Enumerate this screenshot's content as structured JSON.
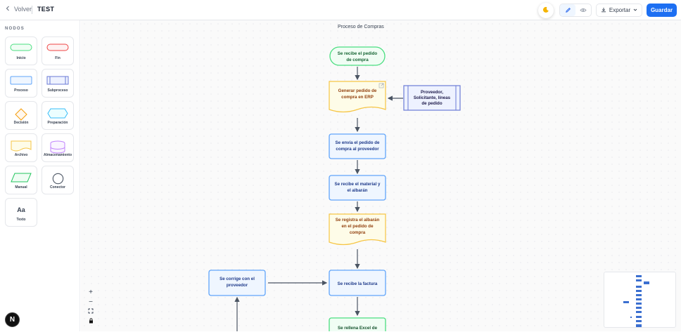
{
  "header": {
    "back_label": "Volver",
    "doc_title": "TEST",
    "export_label": "Exportar",
    "save_label": "Guardar"
  },
  "sidebar": {
    "title": "NODOS",
    "nodes": [
      {
        "label": "Inicio"
      },
      {
        "label": "Fin"
      },
      {
        "label": "Proceso"
      },
      {
        "label": "Subproceso"
      },
      {
        "label": "Decisión"
      },
      {
        "label": "Preparación"
      },
      {
        "label": "Archivo"
      },
      {
        "label": "Almacenamiento"
      },
      {
        "label": "Manual"
      },
      {
        "label": "Conector"
      },
      {
        "label": "Texto",
        "glyph": "Aa"
      }
    ]
  },
  "canvas": {
    "title": "Proceso de Compras",
    "nodes": {
      "start": [
        "Se recibe el pedido",
        "de compra"
      ],
      "erp": [
        "Generar pedido de",
        "compra en ERP"
      ],
      "supplier": [
        "Proveedor,",
        "Solicitante, líneas",
        "de pedido"
      ],
      "send": [
        "Se envía el pedido de",
        "compra al proveedor"
      ],
      "receive": [
        "Se recibe el material y",
        "el albarán"
      ],
      "register": [
        "Se registra el albarán",
        "en el pedido de",
        "compra"
      ],
      "invoice": [
        "Se recibe la factura"
      ],
      "correct": [
        "Se corrige con el",
        "proveedor"
      ],
      "excel": [
        "Se rellena Excel de"
      ]
    }
  },
  "zoom_controls": {
    "zoom_in": "+",
    "zoom_out": "−"
  },
  "logo_letter": "N",
  "colors": {
    "accent": "#1d6ff2",
    "start_border": "#4ade80",
    "process_border": "#60a5fa",
    "doc_border": "#f6c544",
    "subprocess_border": "#6b7bd6"
  }
}
